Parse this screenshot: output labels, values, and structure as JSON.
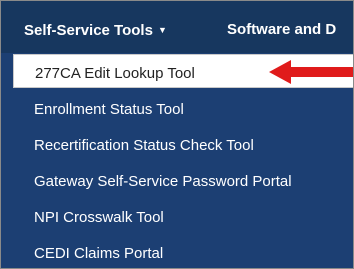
{
  "navbar": {
    "items": [
      {
        "label": "Self-Service Tools",
        "has_dropdown": true
      },
      {
        "label": "Software and D"
      }
    ]
  },
  "dropdown": {
    "items": [
      {
        "label": "277CA Edit Lookup Tool",
        "highlighted": true
      },
      {
        "label": "Enrollment Status Tool"
      },
      {
        "label": "Recertification Status Check Tool"
      },
      {
        "label": "Gateway Self-Service Password Portal"
      },
      {
        "label": "NPI Crosswalk Tool"
      },
      {
        "label": "CEDI Claims Portal"
      }
    ]
  },
  "colors": {
    "navbar_bg": "#17375f",
    "menu_bg": "#1c3f73",
    "highlight_bg": "#ffffff",
    "arrow": "#e01b1b"
  },
  "icons": {
    "caret": "caret-down-icon",
    "pointer": "red-arrow-icon"
  }
}
